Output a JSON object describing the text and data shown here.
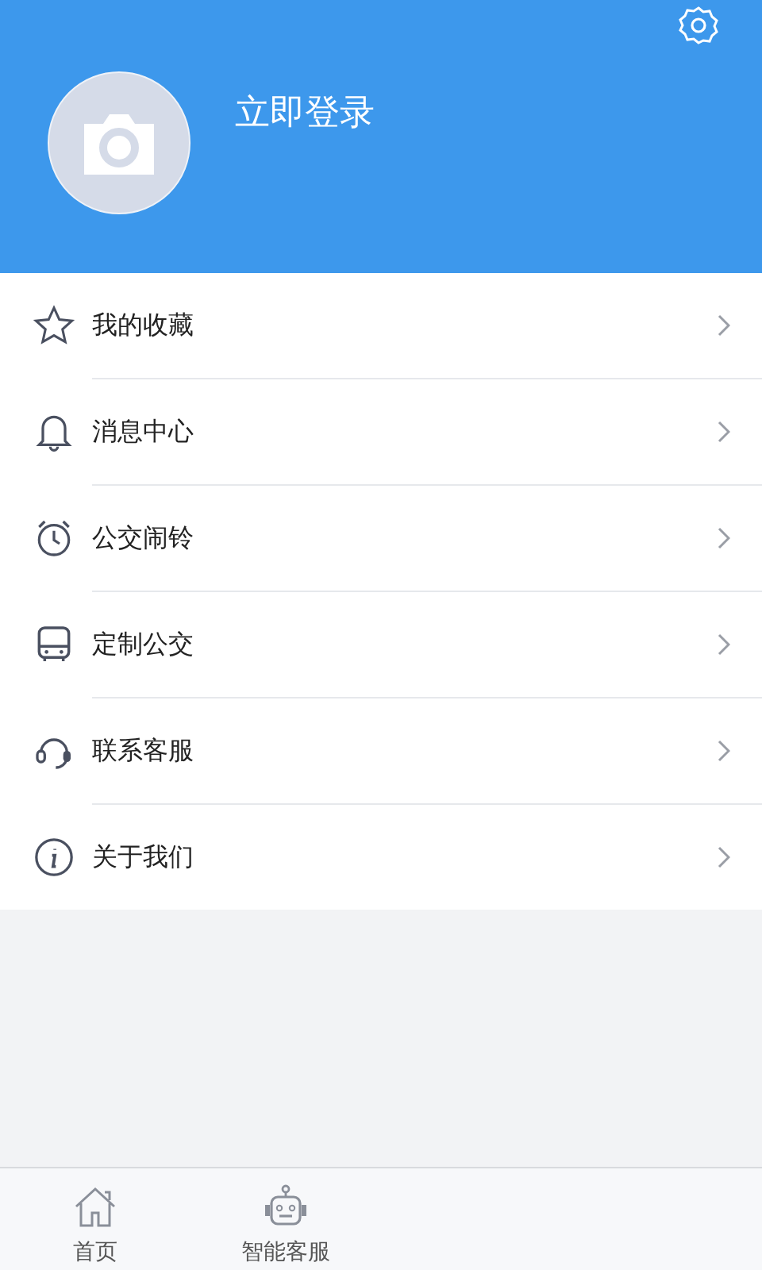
{
  "header": {
    "login_label": "立即登录"
  },
  "menu": [
    {
      "kind": "star",
      "label": "我的收藏"
    },
    {
      "kind": "bell",
      "label": "消息中心"
    },
    {
      "kind": "alarm",
      "label": "公交闹铃"
    },
    {
      "kind": "bus",
      "label": "定制公交"
    },
    {
      "kind": "headset",
      "label": "联系客服"
    },
    {
      "kind": "info",
      "label": "关于我们"
    }
  ],
  "tab_bar": [
    {
      "kind": "home",
      "label": "首页"
    },
    {
      "kind": "robot",
      "label": "智能客服"
    }
  ]
}
